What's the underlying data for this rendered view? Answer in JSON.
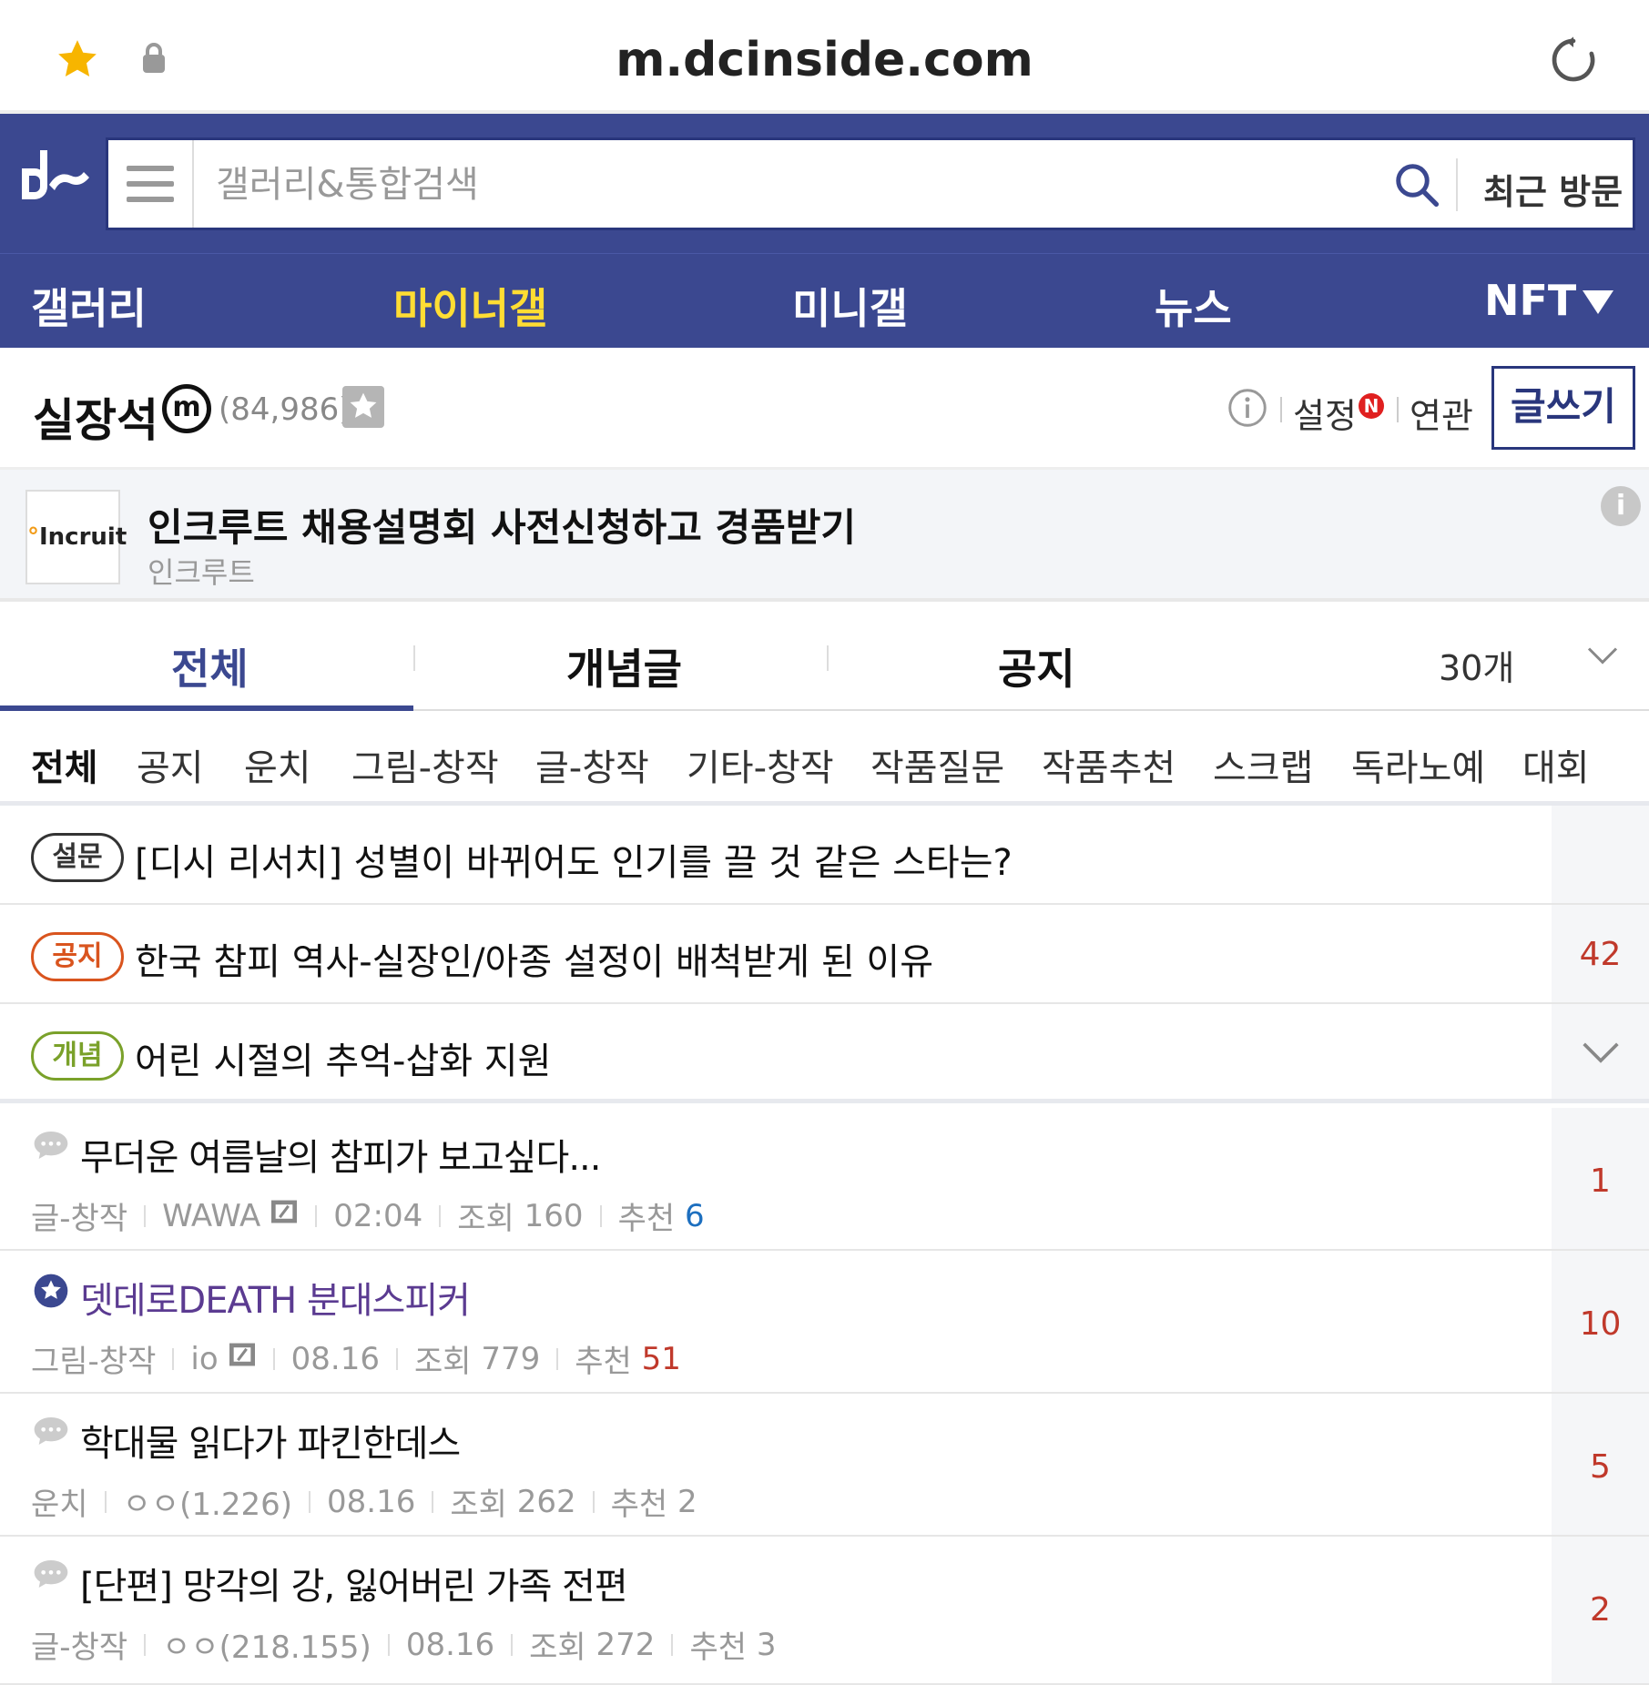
{
  "browser": {
    "url": "m.dcinside.com"
  },
  "search": {
    "placeholder": "갤러리&통합검색",
    "recent_label": "최근 방문"
  },
  "nav": {
    "items": [
      "갤러리",
      "마이너갤",
      "미니갤",
      "뉴스",
      "NFT"
    ],
    "active_index": 1
  },
  "gallery": {
    "title": "실장석",
    "badge": "m",
    "member_count": "(84,986)",
    "setting_label": "설정",
    "new_badge": "N",
    "related_label": "연관",
    "write_label": "글쓰기"
  },
  "ad": {
    "logo_dot": "°",
    "logo_text": "Incruit",
    "title": "인크루트 채용설명회 사전신청하고 경품받기",
    "advertiser": "인크루트",
    "info_label": "i"
  },
  "tabs": {
    "items": [
      "전체",
      "개념글",
      "공지"
    ],
    "active_index": 0,
    "count_label": "30개"
  },
  "heads": [
    "전체",
    "공지",
    "운치",
    "그림-창작",
    "글-창작",
    "기타-창작",
    "작품질문",
    "작품추천",
    "스크랩",
    "독라노예",
    "대회"
  ],
  "notices": [
    {
      "badge": "설문",
      "title": "[디시 리서치] 성별이 바뀌어도 인기를 끌 것 같은 스타는?",
      "comments": "",
      "badge_color": "#333333"
    },
    {
      "badge": "공지",
      "title": "한국 참피 역사-실장인/아종 설정이 배척받게 된 이유",
      "comments": "42",
      "badge_color": "#d9541e"
    },
    {
      "badge": "개념",
      "title": "어린 시절의 추억-삽화 지원",
      "comments": "",
      "badge_color": "#7aa12a"
    }
  ],
  "posts": [
    {
      "title": "무더운 여름날의 참피가 보고싶다...",
      "category": "글-창작",
      "author": "WAWA",
      "time": "02:04",
      "views_label": "조회",
      "views": "160",
      "reco_label": "추천",
      "reco": "6",
      "comments": "1",
      "icon": "speech-bubble-icon"
    },
    {
      "title": "뎃데로DEATH 분대스피커",
      "category": "그림-창작",
      "author": "io",
      "time": "08.16",
      "views_label": "조회",
      "views": "779",
      "reco_label": "추천",
      "reco": "51",
      "comments": "10",
      "icon": "recommend-star-icon"
    },
    {
      "title": "학대물 읽다가 파킨한데스",
      "category": "운치",
      "author": "ㅇㅇ(1.226)",
      "time": "08.16",
      "views_label": "조회",
      "views": "262",
      "reco_label": "추천",
      "reco": "2",
      "comments": "5",
      "icon": "speech-bubble-icon"
    },
    {
      "title": "[단편] 망각의 강, 잃어버린 가족 전편",
      "category": "글-창작",
      "author": "ㅇㅇ(218.155)",
      "time": "08.16",
      "views_label": "조회",
      "views": "272",
      "reco_label": "추천",
      "reco": "3",
      "comments": "2",
      "icon": "speech-bubble-icon"
    }
  ],
  "colors": {
    "brand": "#3b4890",
    "active_nav": "#ffdd33",
    "comment_red": "#c0392b",
    "reco_blue": "#1d6fbf",
    "recommend_purple": "#5b3b91"
  }
}
